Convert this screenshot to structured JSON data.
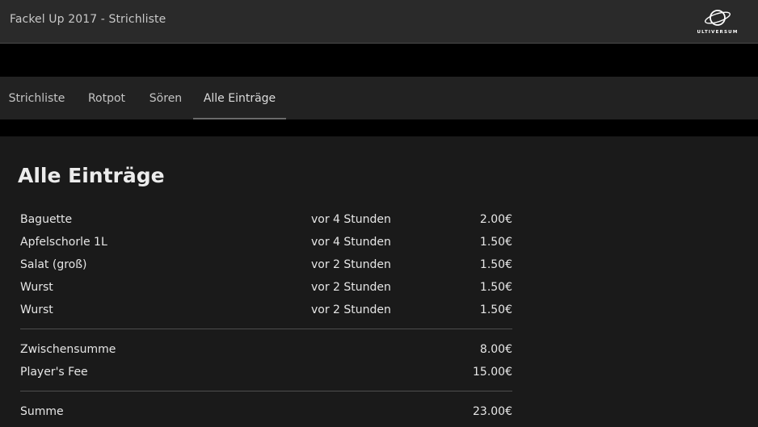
{
  "app": {
    "title": "Fackel Up 2017 - Strichliste",
    "logo_text": "ULTIVERSUM"
  },
  "nav": {
    "tabs": [
      {
        "label": "Strichliste"
      },
      {
        "label": "Rotpot"
      },
      {
        "label": "Sören"
      },
      {
        "label": "Alle Einträge",
        "active": true
      }
    ]
  },
  "main": {
    "title": "Alle Einträge",
    "entries": [
      {
        "name": "Baguette",
        "time": "vor 4 Stunden",
        "price": "2.00€"
      },
      {
        "name": "Apfelschorle 1L",
        "time": "vor 4 Stunden",
        "price": "1.50€"
      },
      {
        "name": "Salat (groß)",
        "time": "vor 2 Stunden",
        "price": "1.50€"
      },
      {
        "name": "Wurst",
        "time": "vor 2 Stunden",
        "price": "1.50€"
      },
      {
        "name": "Wurst",
        "time": "vor 2 Stunden",
        "price": "1.50€"
      }
    ],
    "subtotal": {
      "label": "Zwischensumme",
      "value": "8.00€"
    },
    "fee": {
      "label": "Player's Fee",
      "value": "15.00€"
    },
    "total": {
      "label": "Summe",
      "value": "23.00€"
    }
  }
}
